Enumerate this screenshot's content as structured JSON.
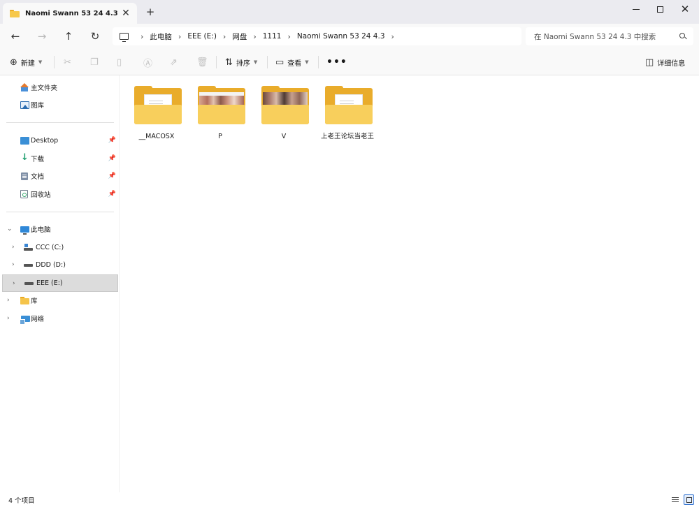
{
  "window": {
    "tab_title": "Naomi Swann 53 24 4.3",
    "close_tab_glyph": "✕",
    "new_tab_glyph": "+",
    "close_glyph": "✕"
  },
  "nav": {
    "back_glyph": "←",
    "forward_glyph": "→",
    "up_glyph": "↑",
    "refresh_glyph": "↻",
    "breadcrumbs": [
      "此电脑",
      "EEE (E:)",
      "网盘",
      "1111",
      "Naomi Swann 53 24 4.3"
    ],
    "separator": "›",
    "search_placeholder": "在 Naomi Swann 53 24 4.3 中搜索"
  },
  "toolbar": {
    "new_label": "新建",
    "sort_label": "排序",
    "view_label": "查看",
    "details_label": "详细信息",
    "more_glyph": "•••"
  },
  "sidebar": {
    "home": "主文件夹",
    "gallery": "图库",
    "pinned": [
      "Desktop",
      "下载",
      "文档",
      "回收站"
    ],
    "this_pc": "此电脑",
    "drives": [
      "CCC (C:)",
      "DDD (D:)",
      "EEE (E:)"
    ],
    "library": "库",
    "network": "网络",
    "selected": "EEE (E:)"
  },
  "files": [
    {
      "name": "__MACOSX",
      "thumbnail": "document"
    },
    {
      "name": "P",
      "thumbnail": "photos"
    },
    {
      "name": "V",
      "thumbnail": "video-frames"
    },
    {
      "name": "上老王论坛当老王",
      "thumbnail": "document"
    }
  ],
  "status": {
    "item_count": "4 个项目"
  },
  "colors": {
    "accent": "#2d6fd0",
    "folder_front": "#f8cf5c",
    "folder_back": "#e9ac2b",
    "selected_bg": "#dcdcdc"
  }
}
